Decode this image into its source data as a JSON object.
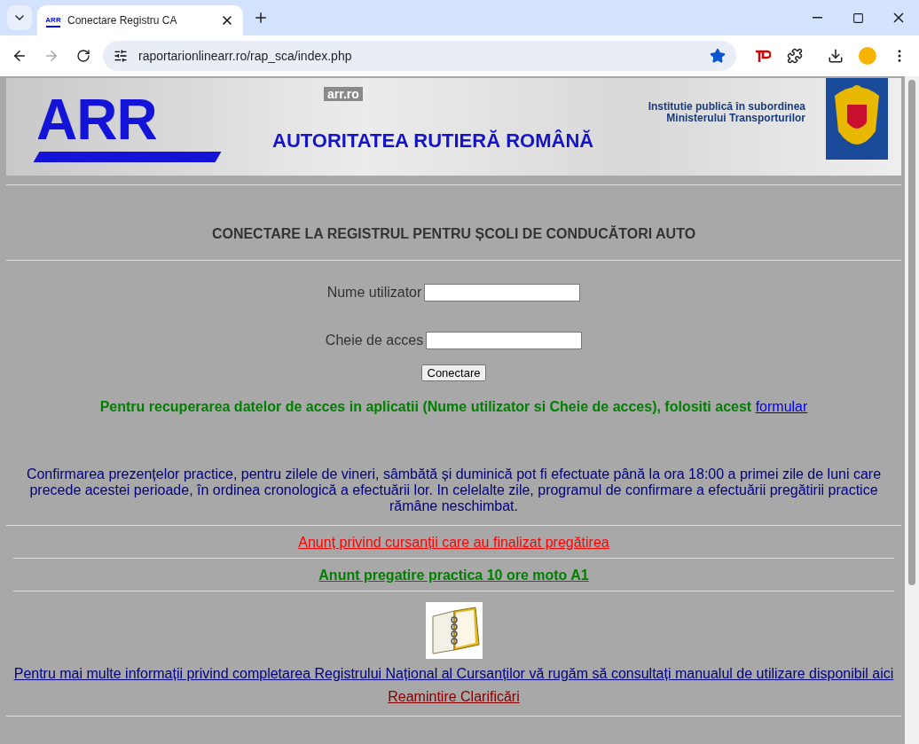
{
  "browser": {
    "favicon": "ARR",
    "tab_title": "Conectare Registru CA",
    "url": "raportarionlinearr.ro/rap_sca/index.php",
    "bookmarked": true
  },
  "banner": {
    "logo": "ARR",
    "site": "arr.ro",
    "subordination": [
      "Institutie publică în subordinea",
      "Ministerului Transporturilor"
    ],
    "authority": "AUTORITATEA RUTIERĂ ROMÂNĂ"
  },
  "title": "CONECTARE LA REGISTRUL PENTRU ȘCOLI DE CONDUCĂTORI AUTO",
  "form": {
    "fields": [
      {
        "label": "Nume utilizator"
      },
      {
        "label": "Cheie de acces"
      }
    ],
    "submit": "Conectare"
  },
  "recovery": {
    "text": "Pentru recuperarea datelor de acces in aplicatii (Nume utilizator si Cheie de acces), folositi acest ",
    "link": "formular"
  },
  "notice": "Confirmarea prezențelor practice, pentru zilele de vineri, sâmbătă și duminică pot fi efectuate până la ora 18:00 a primei zile de luni care precede acestei perioade, în ordinea cronologică a efectuării lor. In celelalte zile, programul de confirmare a efectuării pregătirii practice rămâne neschimbat.",
  "announcements": [
    {
      "text": "Anunț privind cursanții care au finalizat pregătirea",
      "color": "#ff0000",
      "bold": false
    },
    {
      "text": "Anunt pregatire practica 10 ore moto A1",
      "color": "#008000",
      "bold": true
    }
  ],
  "manual_link": {
    "text": "Pentru mai multe informații privind completarea Registrului Național al Cursanților vă rugăm să consultați manualul de utilizare disponibil aici",
    "color": "#000080"
  },
  "reminder_link": {
    "text": "Reamintire Clarificări",
    "color": "#800000"
  }
}
